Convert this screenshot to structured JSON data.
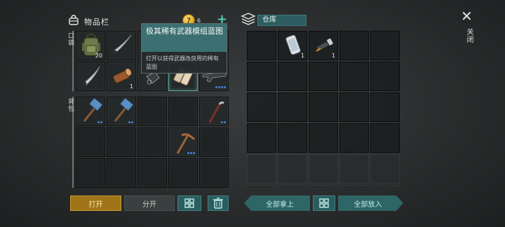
{
  "inventory": {
    "title": "物品栏",
    "icon": "bag-icon",
    "coin_symbol": "?",
    "coin_count": "6",
    "add_symbol": "+",
    "pocket_label": "口袋",
    "backpack_label": "背包",
    "slots": [
      {
        "item": "backpack",
        "qty": "20"
      },
      {
        "item": "machete",
        "qty": ""
      },
      {
        "item": "hidden",
        "qty": ""
      },
      {
        "item": "hidden",
        "qty": ""
      },
      {
        "item": "hidden",
        "qty": ""
      },
      {
        "item": "machete",
        "qty": ""
      },
      {
        "item": "wood-log",
        "qty": "1"
      },
      {
        "item": "tool-blueprint",
        "qty": ""
      },
      {
        "item": "blueprint",
        "qty": ""
      },
      {
        "item": "rifle",
        "qty": ""
      }
    ],
    "backpack": [
      {
        "item": "hammer",
        "dots": 2
      },
      {
        "item": "hammer",
        "dots": 2
      },
      {
        "item": "",
        "dots": 0
      },
      {
        "item": "",
        "dots": 0
      },
      {
        "item": "crowbar",
        "dots": 2
      },
      {
        "item": "",
        "dots": 0
      },
      {
        "item": "",
        "dots": 0
      },
      {
        "item": "",
        "dots": 0
      },
      {
        "item": "pickaxe",
        "dots": 3
      },
      {
        "item": "",
        "dots": 0
      },
      {
        "item": "",
        "dots": 0
      },
      {
        "item": "",
        "dots": 0
      },
      {
        "item": "",
        "dots": 0
      },
      {
        "item": "",
        "dots": 0
      },
      {
        "item": "",
        "dots": 0
      }
    ]
  },
  "tooltip": {
    "title": "极其稀有武器模组蓝图",
    "description": "打开以获得武器改良用的稀有蓝图"
  },
  "warehouse": {
    "title": "仓库",
    "icon": "stack-icon",
    "items": [
      {
        "item": "phone",
        "qty": "1"
      },
      {
        "item": "flashlight",
        "qty": "1"
      }
    ]
  },
  "close": {
    "symbol": "✕",
    "label": "关闭"
  },
  "buttons": {
    "open": "打开",
    "split": "分开",
    "take_all": "全部拿上",
    "put_all": "全部放入"
  },
  "colors": {
    "accent_teal": "#2e6565",
    "gold": "#a07519",
    "highlight": "#5aa895",
    "rarity_dot": "#4a7fd6"
  }
}
